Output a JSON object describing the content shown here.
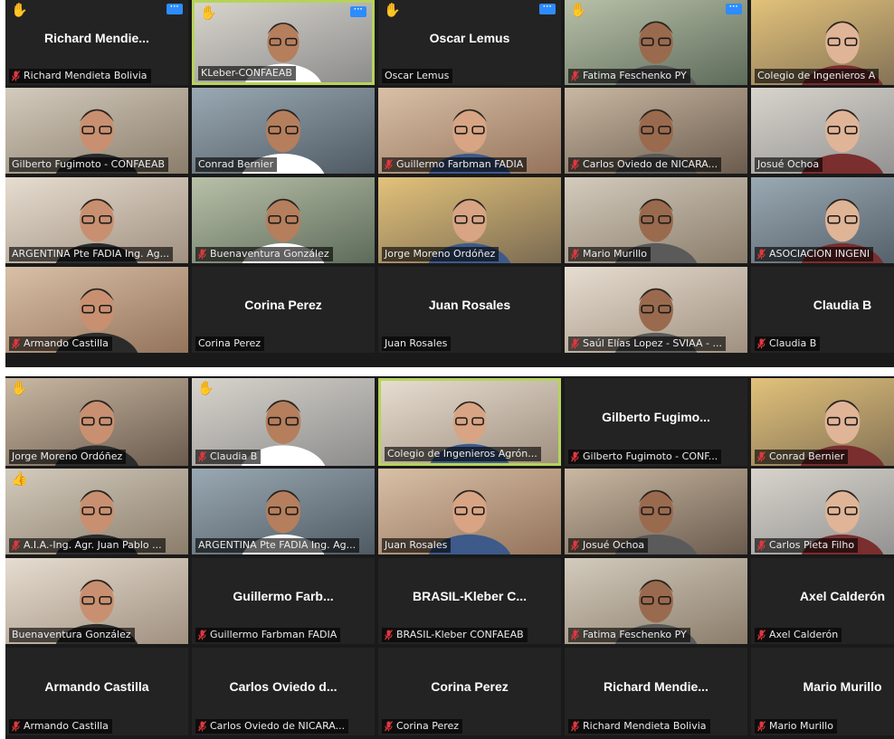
{
  "colors": {
    "speaker_border": "#b6d35a",
    "mic_muted": "#e0383e",
    "hand": "#f3b53f",
    "more_button": "#2d8cff"
  },
  "icons": {
    "mic_muted": "mic-muted-icon",
    "hand": "raised-hand-icon",
    "more": "more-options-icon"
  },
  "top_grid": [
    {
      "name": "Richard Mendieta Bolivia",
      "big": "Richard  Mendie...",
      "video": false,
      "muted": true,
      "hand": true,
      "more": true
    },
    {
      "name": "KLeber-CONFAEAB",
      "video": true,
      "muted": false,
      "hand": true,
      "more": true,
      "speaking": true
    },
    {
      "name": "Oscar Lemus",
      "big": "Oscar Lemus",
      "video": false,
      "muted": false,
      "hand": true,
      "more": true
    },
    {
      "name": "Fatima Feschenko PY",
      "video": true,
      "muted": true,
      "hand": true,
      "more": true
    },
    {
      "name": "Colegio de Ingenieros A",
      "video": true,
      "muted": false
    },
    {
      "name": "Gilberto Fugimoto - CONFAEAB",
      "video": true,
      "muted": false
    },
    {
      "name": "Conrad Bernier",
      "video": true,
      "muted": false
    },
    {
      "name": "Guillermo Farbman FADIA",
      "video": true,
      "muted": true
    },
    {
      "name": "Carlos Oviedo de NICARA...",
      "video": true,
      "muted": true
    },
    {
      "name": "Josué Ochoa",
      "video": true,
      "muted": false
    },
    {
      "name": "ARGENTINA Pte FADIA Ing. Ag...",
      "video": true,
      "muted": false
    },
    {
      "name": "Buenaventura González",
      "video": true,
      "muted": true
    },
    {
      "name": "Jorge Moreno Ordóñez",
      "video": true,
      "muted": false
    },
    {
      "name": "Mario Murillo",
      "video": true,
      "muted": true
    },
    {
      "name": "ASOCIACION INGENI",
      "video": true,
      "muted": true
    },
    {
      "name": "Armando Castilla",
      "video": true,
      "muted": true
    },
    {
      "name": "Corina Perez",
      "big": "Corina Perez",
      "video": false,
      "muted": false
    },
    {
      "name": "Juan Rosales",
      "big": "Juan Rosales",
      "video": false,
      "muted": false
    },
    {
      "name": "Saúl Elías Lopez - SVIAA - ...",
      "video": true,
      "muted": true
    },
    {
      "name": "Claudia B",
      "big": "Claudia B",
      "video": false,
      "muted": true
    }
  ],
  "bottom_grid": [
    {
      "name": "Jorge Moreno Ordóñez",
      "video": true,
      "muted": false,
      "hand": true
    },
    {
      "name": "Claudia B",
      "video": true,
      "muted": true,
      "hand": true
    },
    {
      "name": "Colegio de Ingenieros Agrón...",
      "video": true,
      "muted": false,
      "speaking": true
    },
    {
      "name": "Gilberto Fugimoto - CONF...",
      "big": "Gilberto  Fugimo...",
      "video": false,
      "muted": true
    },
    {
      "name": "Conrad Bernier",
      "video": true,
      "muted": true
    },
    {
      "name": "A.I.A.-Ing. Agr. Juan Pablo ...",
      "video": true,
      "muted": true,
      "thumb": true
    },
    {
      "name": "ARGENTINA Pte FADIA Ing. Ag...",
      "video": true,
      "muted": false
    },
    {
      "name": "Juan Rosales",
      "video": true,
      "muted": false
    },
    {
      "name": "Josué Ochoa",
      "video": true,
      "muted": true
    },
    {
      "name": "Carlos Pieta Filho",
      "video": true,
      "muted": true
    },
    {
      "name": "Buenaventura González",
      "video": true,
      "muted": false
    },
    {
      "name": "Guillermo Farbman FADIA",
      "big": "Guillermo  Farb...",
      "video": false,
      "muted": true
    },
    {
      "name": "BRASIL-Kleber CONFAEAB",
      "big": "BRASIL-Kleber  C...",
      "video": false,
      "muted": true
    },
    {
      "name": "Fatima Feschenko PY",
      "video": true,
      "muted": true
    },
    {
      "name": "Axel  Calderón",
      "big": "Axel  Calderón",
      "video": false,
      "muted": true
    },
    {
      "name": "Armando Castilla",
      "big": "Armando Castilla",
      "video": false,
      "muted": true
    },
    {
      "name": "Carlos Oviedo de NICARA...",
      "big": "Carlos  Oviedo  d...",
      "video": false,
      "muted": true
    },
    {
      "name": "Corina Perez",
      "big": "Corina Perez",
      "video": false,
      "muted": true
    },
    {
      "name": "Richard Mendieta Bolivia",
      "big": "Richard  Mendie...",
      "video": false,
      "muted": true
    },
    {
      "name": "Mario Murillo",
      "big": "Mario Murillo",
      "video": false,
      "muted": true
    }
  ]
}
